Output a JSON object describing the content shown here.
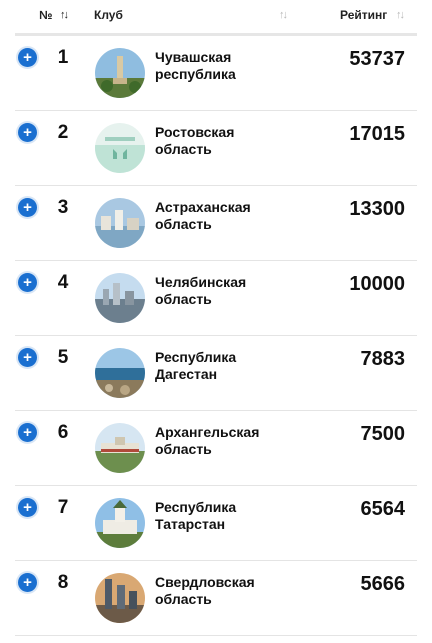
{
  "header": {
    "num_label": "№",
    "num_sort": "↑↓",
    "club_label": "Клуб",
    "club_sort": "↑↓",
    "rating_label": "Рейтинг",
    "rating_sort": "↑↓"
  },
  "rows": [
    {
      "rank": "1",
      "name_line1": "Чувашская",
      "name_line2": "республика",
      "rating": "53737",
      "expand": "+"
    },
    {
      "rank": "2",
      "name_line1": "Ростовская",
      "name_line2": "область",
      "rating": "17015",
      "expand": "+"
    },
    {
      "rank": "3",
      "name_line1": "Астраханская",
      "name_line2": "область",
      "rating": "13300",
      "expand": "+"
    },
    {
      "rank": "4",
      "name_line1": "Челябинская",
      "name_line2": "область",
      "rating": "10000",
      "expand": "+"
    },
    {
      "rank": "5",
      "name_line1": "Республика",
      "name_line2": "Дагестан",
      "rating": "7883",
      "expand": "+"
    },
    {
      "rank": "6",
      "name_line1": "Архангельская",
      "name_line2": "область",
      "rating": "7500",
      "expand": "+"
    },
    {
      "rank": "7",
      "name_line1": "Республика",
      "name_line2": "Татарстан",
      "rating": "6564",
      "expand": "+"
    },
    {
      "rank": "8",
      "name_line1": "Свердловская",
      "name_line2": "область",
      "rating": "5666",
      "expand": "+"
    }
  ],
  "colors": {
    "expand_button": "#1a6fd0",
    "active_sort": "#222222",
    "inactive_sort": "#b8b8b8"
  }
}
